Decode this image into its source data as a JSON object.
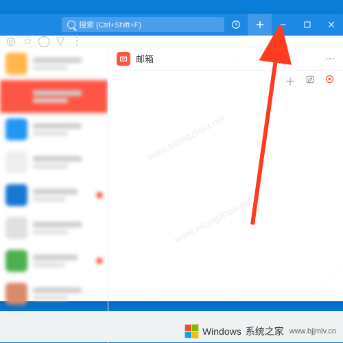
{
  "titlebar": {
    "search_placeholder": "搜索 (Ctrl+Shift+F)"
  },
  "main": {
    "title": "邮箱"
  },
  "footer": {
    "brand": "Windows",
    "subbrand": "系统之家",
    "url": "www.bjjmlv.cn"
  },
  "watermark": "www.xitongzhijia.net",
  "colors": {
    "accent": "#1e88e5",
    "highlight": "#ff5546"
  },
  "sidebar_items": [
    {
      "color": "#ffb74d",
      "selected": false,
      "badge": false
    },
    {
      "color": "#ff5546",
      "selected": true,
      "badge": false
    },
    {
      "color": "#2196f3",
      "selected": false,
      "badge": false
    },
    {
      "color": "#eeeeee",
      "selected": false,
      "badge": false
    },
    {
      "color": "#1976d2",
      "selected": false,
      "badge": true
    },
    {
      "color": "#e0e0e0",
      "selected": false,
      "badge": false
    },
    {
      "color": "#4caf50",
      "selected": false,
      "badge": true
    },
    {
      "color": "#d88a6c",
      "selected": false,
      "badge": false
    },
    {
      "color": "#eeeeee",
      "selected": false,
      "badge": false
    }
  ]
}
